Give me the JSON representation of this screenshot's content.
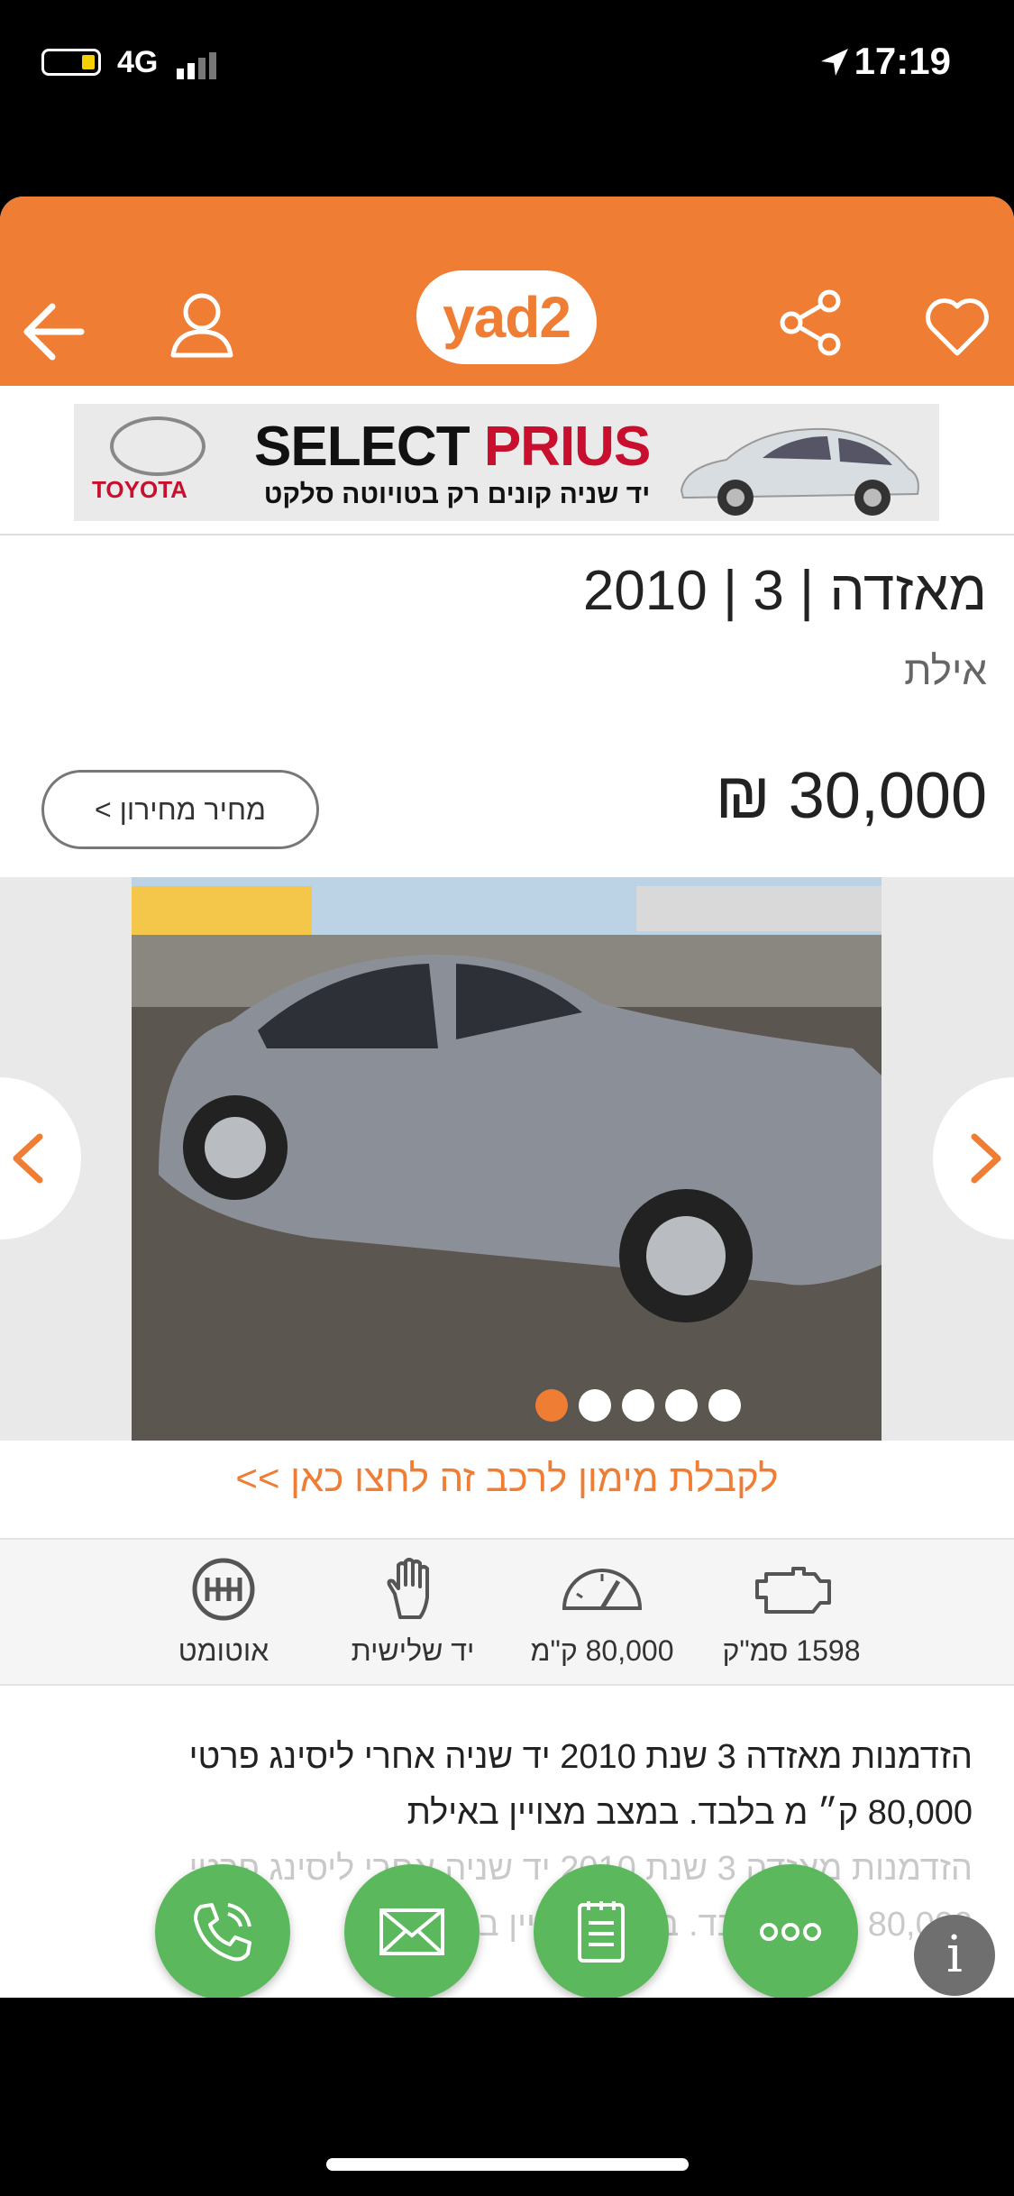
{
  "status_bar": {
    "network": "4G",
    "time": "17:19"
  },
  "header": {
    "logo_text": "yad2",
    "brand_color": "#ef7d34"
  },
  "banner": {
    "brand": "TOYOTA",
    "headline_part1": "SELECT ",
    "headline_part2": "PRIUS",
    "subline": "יד שניה קונים רק בטויוטה סלקט"
  },
  "listing": {
    "title": "מאזדה | 3 | 2010",
    "city": "אילת",
    "price": "30,000 ₪",
    "pricelist_button": "מחיר מחירון >"
  },
  "gallery": {
    "total_images": 5,
    "current_index": 1
  },
  "finance_link": "לקבלת מימון לרכב זה לחצו כאן >>",
  "specs": [
    {
      "icon": "engine-icon",
      "label": "1598 סמ\"ק"
    },
    {
      "icon": "speedometer-icon",
      "label": "80,000 ק\"מ"
    },
    {
      "icon": "hand-icon",
      "label": "יד שלישית"
    },
    {
      "icon": "gearbox-icon",
      "label": "אוטומט"
    }
  ],
  "description": {
    "line1": "הזדמנות מאזדה 3 שנת 2010 יד שניה אחרי ליסינג פרטי",
    "line2": "80,000 ק״ מ בלבד. במצב מצויין באילת"
  },
  "actions": [
    "phone-icon",
    "mail-icon",
    "notepad-icon",
    "more-icon"
  ],
  "info_label": "i"
}
